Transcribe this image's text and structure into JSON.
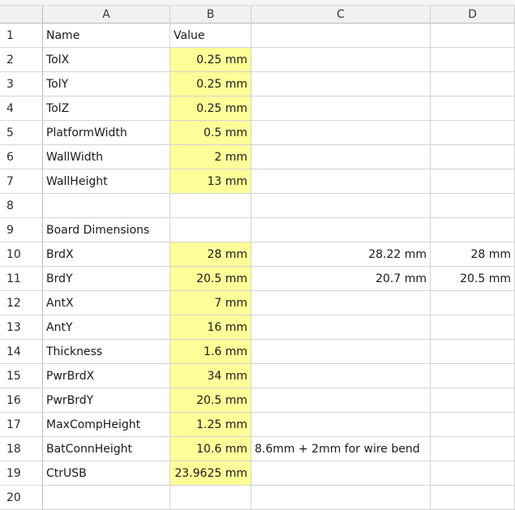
{
  "columns": [
    "A",
    "B",
    "C",
    "D"
  ],
  "rows": [
    {
      "num": "1",
      "a": "Name",
      "b": "Value",
      "b_align": "left",
      "b_highlight": false,
      "c": "",
      "c_align": "right",
      "d": ""
    },
    {
      "num": "2",
      "a": "TolX",
      "b": "0.25 mm",
      "b_align": "right",
      "b_highlight": true,
      "c": "",
      "c_align": "right",
      "d": ""
    },
    {
      "num": "3",
      "a": "TolY",
      "b": "0.25 mm",
      "b_align": "right",
      "b_highlight": true,
      "c": "",
      "c_align": "right",
      "d": ""
    },
    {
      "num": "4",
      "a": "TolZ",
      "b": "0.25 mm",
      "b_align": "right",
      "b_highlight": true,
      "c": "",
      "c_align": "right",
      "d": ""
    },
    {
      "num": "5",
      "a": "PlatformWidth",
      "b": "0.5 mm",
      "b_align": "right",
      "b_highlight": true,
      "c": "",
      "c_align": "right",
      "d": ""
    },
    {
      "num": "6",
      "a": "WallWidth",
      "b": "2 mm",
      "b_align": "right",
      "b_highlight": true,
      "c": "",
      "c_align": "right",
      "d": ""
    },
    {
      "num": "7",
      "a": "WallHeight",
      "b": "13 mm",
      "b_align": "right",
      "b_highlight": true,
      "c": "",
      "c_align": "right",
      "d": ""
    },
    {
      "num": "8",
      "a": "",
      "b": "",
      "b_align": "right",
      "b_highlight": false,
      "c": "",
      "c_align": "right",
      "d": ""
    },
    {
      "num": "9",
      "a": "Board Dimensions",
      "b": "",
      "b_align": "right",
      "b_highlight": false,
      "c": "",
      "c_align": "right",
      "d": ""
    },
    {
      "num": "10",
      "a": "BrdX",
      "b": "28 mm",
      "b_align": "right",
      "b_highlight": true,
      "c": "28.22 mm",
      "c_align": "right",
      "d": "28 mm"
    },
    {
      "num": "11",
      "a": "BrdY",
      "b": "20.5 mm",
      "b_align": "right",
      "b_highlight": true,
      "c": "20.7 mm",
      "c_align": "right",
      "d": "20.5 mm"
    },
    {
      "num": "12",
      "a": "AntX",
      "b": "7 mm",
      "b_align": "right",
      "b_highlight": true,
      "c": "",
      "c_align": "right",
      "d": ""
    },
    {
      "num": "13",
      "a": "AntY",
      "b": "16 mm",
      "b_align": "right",
      "b_highlight": true,
      "c": "",
      "c_align": "right",
      "d": ""
    },
    {
      "num": "14",
      "a": "Thickness",
      "b": "1.6 mm",
      "b_align": "right",
      "b_highlight": true,
      "c": "",
      "c_align": "right",
      "d": ""
    },
    {
      "num": "15",
      "a": "PwrBrdX",
      "b": "34 mm",
      "b_align": "right",
      "b_highlight": true,
      "c": "",
      "c_align": "right",
      "d": ""
    },
    {
      "num": "16",
      "a": "PwrBrdY",
      "b": "20.5 mm",
      "b_align": "right",
      "b_highlight": true,
      "c": "",
      "c_align": "right",
      "d": ""
    },
    {
      "num": "17",
      "a": "MaxCompHeight",
      "b": "1.25 mm",
      "b_align": "right",
      "b_highlight": true,
      "c": "",
      "c_align": "right",
      "d": ""
    },
    {
      "num": "18",
      "a": "BatConnHeight",
      "b": "10.6 mm",
      "b_align": "right",
      "b_highlight": true,
      "c": "8.6mm + 2mm for wire bend",
      "c_align": "left",
      "d": ""
    },
    {
      "num": "19",
      "a": "CtrUSB",
      "b": "23.9625 mm",
      "b_align": "right",
      "b_highlight": true,
      "c": "",
      "c_align": "right",
      "d": ""
    },
    {
      "num": "20",
      "a": "",
      "b": "",
      "b_align": "right",
      "b_highlight": false,
      "c": "",
      "c_align": "right",
      "d": ""
    }
  ],
  "colors": {
    "value_highlight": "#ffff99",
    "grid": "#d4d4d4",
    "header_bg": "#f1f1f1"
  }
}
